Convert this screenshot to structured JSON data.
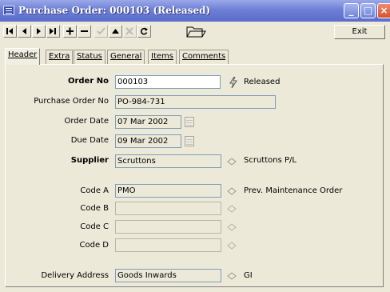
{
  "window": {
    "title": "Purchase Order: 000103  (Released)",
    "controls": {
      "minimize": "_",
      "maximize": "□",
      "close": "×"
    }
  },
  "toolbar": {
    "buttons": [
      {
        "name": "first-record",
        "icon": "first-icon",
        "enabled": true
      },
      {
        "name": "prev-record",
        "icon": "prev-icon",
        "enabled": true
      },
      {
        "name": "next-record",
        "icon": "next-icon",
        "enabled": true
      },
      {
        "name": "last-record",
        "icon": "last-icon",
        "enabled": true
      },
      {
        "name": "add-record",
        "icon": "plus-icon",
        "enabled": true
      },
      {
        "name": "delete-record",
        "icon": "minus-icon",
        "enabled": true
      },
      {
        "name": "post-record",
        "icon": "check-icon",
        "enabled": false
      },
      {
        "name": "edit-record",
        "icon": "up-triangle-icon",
        "enabled": true
      },
      {
        "name": "cancel-record",
        "icon": "x-icon",
        "enabled": false
      },
      {
        "name": "refresh-record",
        "icon": "refresh-icon",
        "enabled": true
      }
    ],
    "open_icon": "folder-icon",
    "exit_label": "Exit"
  },
  "tabs": [
    "Header",
    "Extra",
    "Status",
    "General",
    "Items",
    "Comments"
  ],
  "active_tab": "Header",
  "form": {
    "order_no": {
      "label": "Order No",
      "value": "000103"
    },
    "status_text": "Released",
    "status_icon": "lightning-icon",
    "purchase_order_no": {
      "label": "Purchase Order No",
      "value": "PO-984-731"
    },
    "order_date": {
      "label": "Order Date",
      "value": "07 Mar 2002"
    },
    "due_date": {
      "label": "Due Date",
      "value": "09 Mar 2002"
    },
    "supplier": {
      "label": "Supplier",
      "value": "Scruttons",
      "description": "Scruttons P/L"
    },
    "code_a": {
      "label": "Code A",
      "value": "PMO",
      "description": "Prev. Maintenance Order"
    },
    "code_b": {
      "label": "Code B",
      "value": "",
      "description": ""
    },
    "code_c": {
      "label": "Code C",
      "value": "",
      "description": ""
    },
    "code_d": {
      "label": "Code D",
      "value": "",
      "description": ""
    },
    "delivery_address": {
      "label": "Delivery Address",
      "value": "Goods Inwards",
      "description": "GI"
    }
  },
  "colors": {
    "titlebar": "#6d7fd6",
    "window_bg": "#ece9d8",
    "field_border": "#7f9db9",
    "close_button": "#d6512f"
  }
}
